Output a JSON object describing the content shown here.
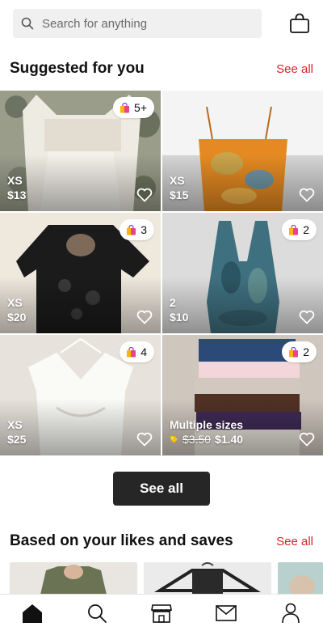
{
  "search": {
    "placeholder": "Search for anything"
  },
  "suggested": {
    "title": "Suggested for you",
    "see_all": "See all",
    "items": [
      {
        "badge": "5+",
        "size": "XS",
        "price": "$13"
      },
      {
        "badge": "",
        "size": "XS",
        "price": "$15"
      },
      {
        "badge": "3",
        "size": "XS",
        "price": "$20"
      },
      {
        "badge": "2",
        "size": "2",
        "price": "$10"
      },
      {
        "badge": "4",
        "size": "XS",
        "price": "$25"
      },
      {
        "badge": "2",
        "size": "Multiple sizes",
        "old_price": "$3.50",
        "price": "$1.40"
      }
    ],
    "see_all_button": "See all"
  },
  "likes": {
    "title": "Based on your likes and saves",
    "see_all": "See all"
  },
  "icons": {
    "search": "search-icon",
    "bag": "shopping-bag-icon",
    "heart": "heart-outline-icon",
    "bundle": "shopping-bag-multicolor-icon",
    "tag": "price-drop-tag-icon",
    "nav": [
      "home-icon",
      "search-icon",
      "shop-icon",
      "mail-icon",
      "profile-icon"
    ]
  },
  "colors": {
    "accent": "#d8232a",
    "button": "#262626"
  }
}
